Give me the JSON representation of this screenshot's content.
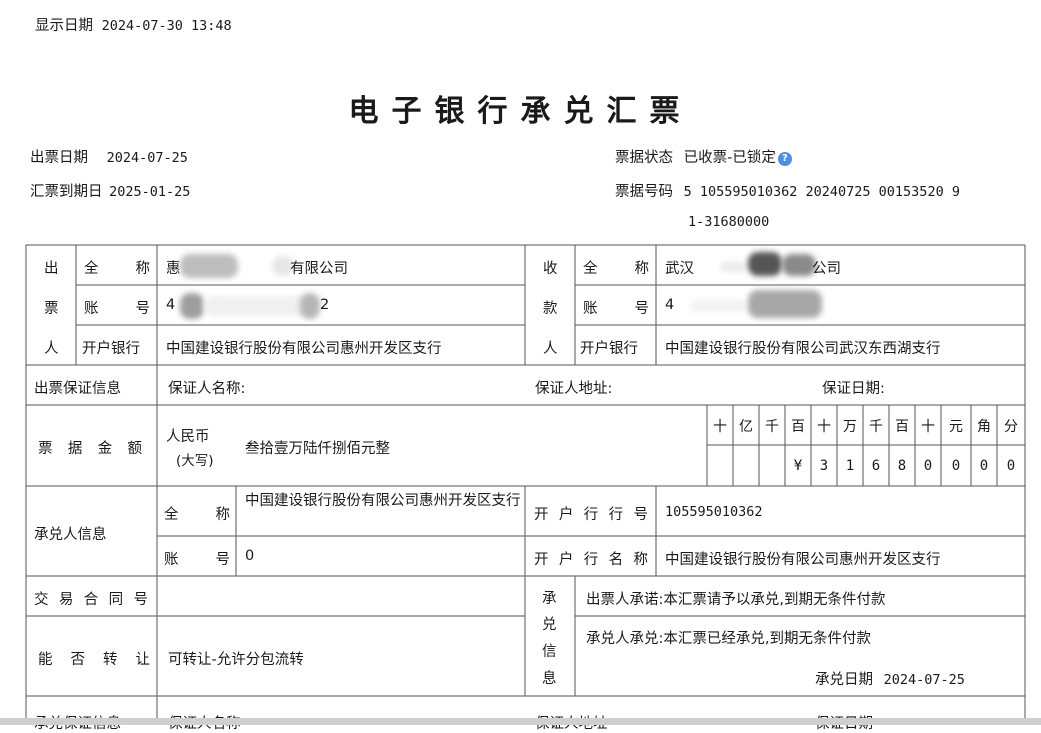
{
  "display_date": {
    "label": "显示日期",
    "value": "2024-07-30 13:48"
  },
  "title": "电子银行承兑汇票",
  "header": {
    "issue_date_label": "出票日期",
    "issue_date": "2024-07-25",
    "due_date_label": "汇票到期日",
    "due_date": "2025-01-25",
    "status_label": "票据状态",
    "status": "已收票-已锁定",
    "bill_no_label": "票据号码",
    "bill_no_line1": "5 105595010362 20240725 00153520 9",
    "bill_no_line2": "1-31680000"
  },
  "drawer": {
    "label_chars": [
      "出",
      "票",
      "人"
    ],
    "name_label": "全 称",
    "name_value": "惠",
    "name_suffix": "有限公司",
    "account_label": "账 号",
    "account_value_start": "4",
    "account_value_end": "2",
    "bank_label": "开户银行",
    "bank_value": "中国建设银行股份有限公司惠州开发区支行"
  },
  "payee": {
    "label_chars": [
      "收",
      "款",
      "人"
    ],
    "name_label": "全 称",
    "name_value": "武汉",
    "name_suffix": "公司",
    "account_label": "账 号",
    "account_value_start": "4",
    "bank_label": "开户银行",
    "bank_value": "中国建设银行股份有限公司武汉东西湖支行"
  },
  "guarantee": {
    "label": "出票保证信息",
    "name_label": "保证人名称:",
    "address_label": "保证人地址:",
    "date_label": "保证日期:"
  },
  "amount": {
    "label": "票据金额",
    "currency_line1": "人民币",
    "currency_line2": "(大写)",
    "words": "叁拾壹万陆仟捌佰元整",
    "units": [
      "十",
      "亿",
      "千",
      "百",
      "十",
      "万",
      "千",
      "百",
      "十",
      "元",
      "角",
      "分"
    ],
    "digits": [
      "",
      "",
      "",
      "¥",
      "3",
      "1",
      "6",
      "8",
      "0",
      "0",
      "0",
      "0"
    ]
  },
  "acceptor": {
    "label": "承兑人信息",
    "name_label": "全 称",
    "name_value": "中国建设银行股份有限公司惠州开发区支行",
    "account_label": "账 号",
    "account_value": "0",
    "bank_no_label": "开户行行号",
    "bank_no": "105595010362",
    "bank_name_label": "开户行名称",
    "bank_name": "中国建设银行股份有限公司惠州开发区支行"
  },
  "contract": {
    "label": "交易合同号",
    "value": ""
  },
  "transfer": {
    "label": "能否转让",
    "value": "可转让-允许分包流转"
  },
  "acceptance": {
    "label_chars": [
      "承",
      "兑",
      "信",
      "息"
    ],
    "drawer_promise": "出票人承诺:本汇票请予以承兑,到期无条件付款",
    "acceptor_promise": "承兑人承兑:本汇票已经承兑,到期无条件付款",
    "date_label": "承兑日期",
    "date": "2024-07-25"
  },
  "acceptance_guarantee": {
    "label": "承兑保证信息",
    "name_label": "保证人名称",
    "address_label": "保证人地址",
    "date_label": "保证日期"
  }
}
